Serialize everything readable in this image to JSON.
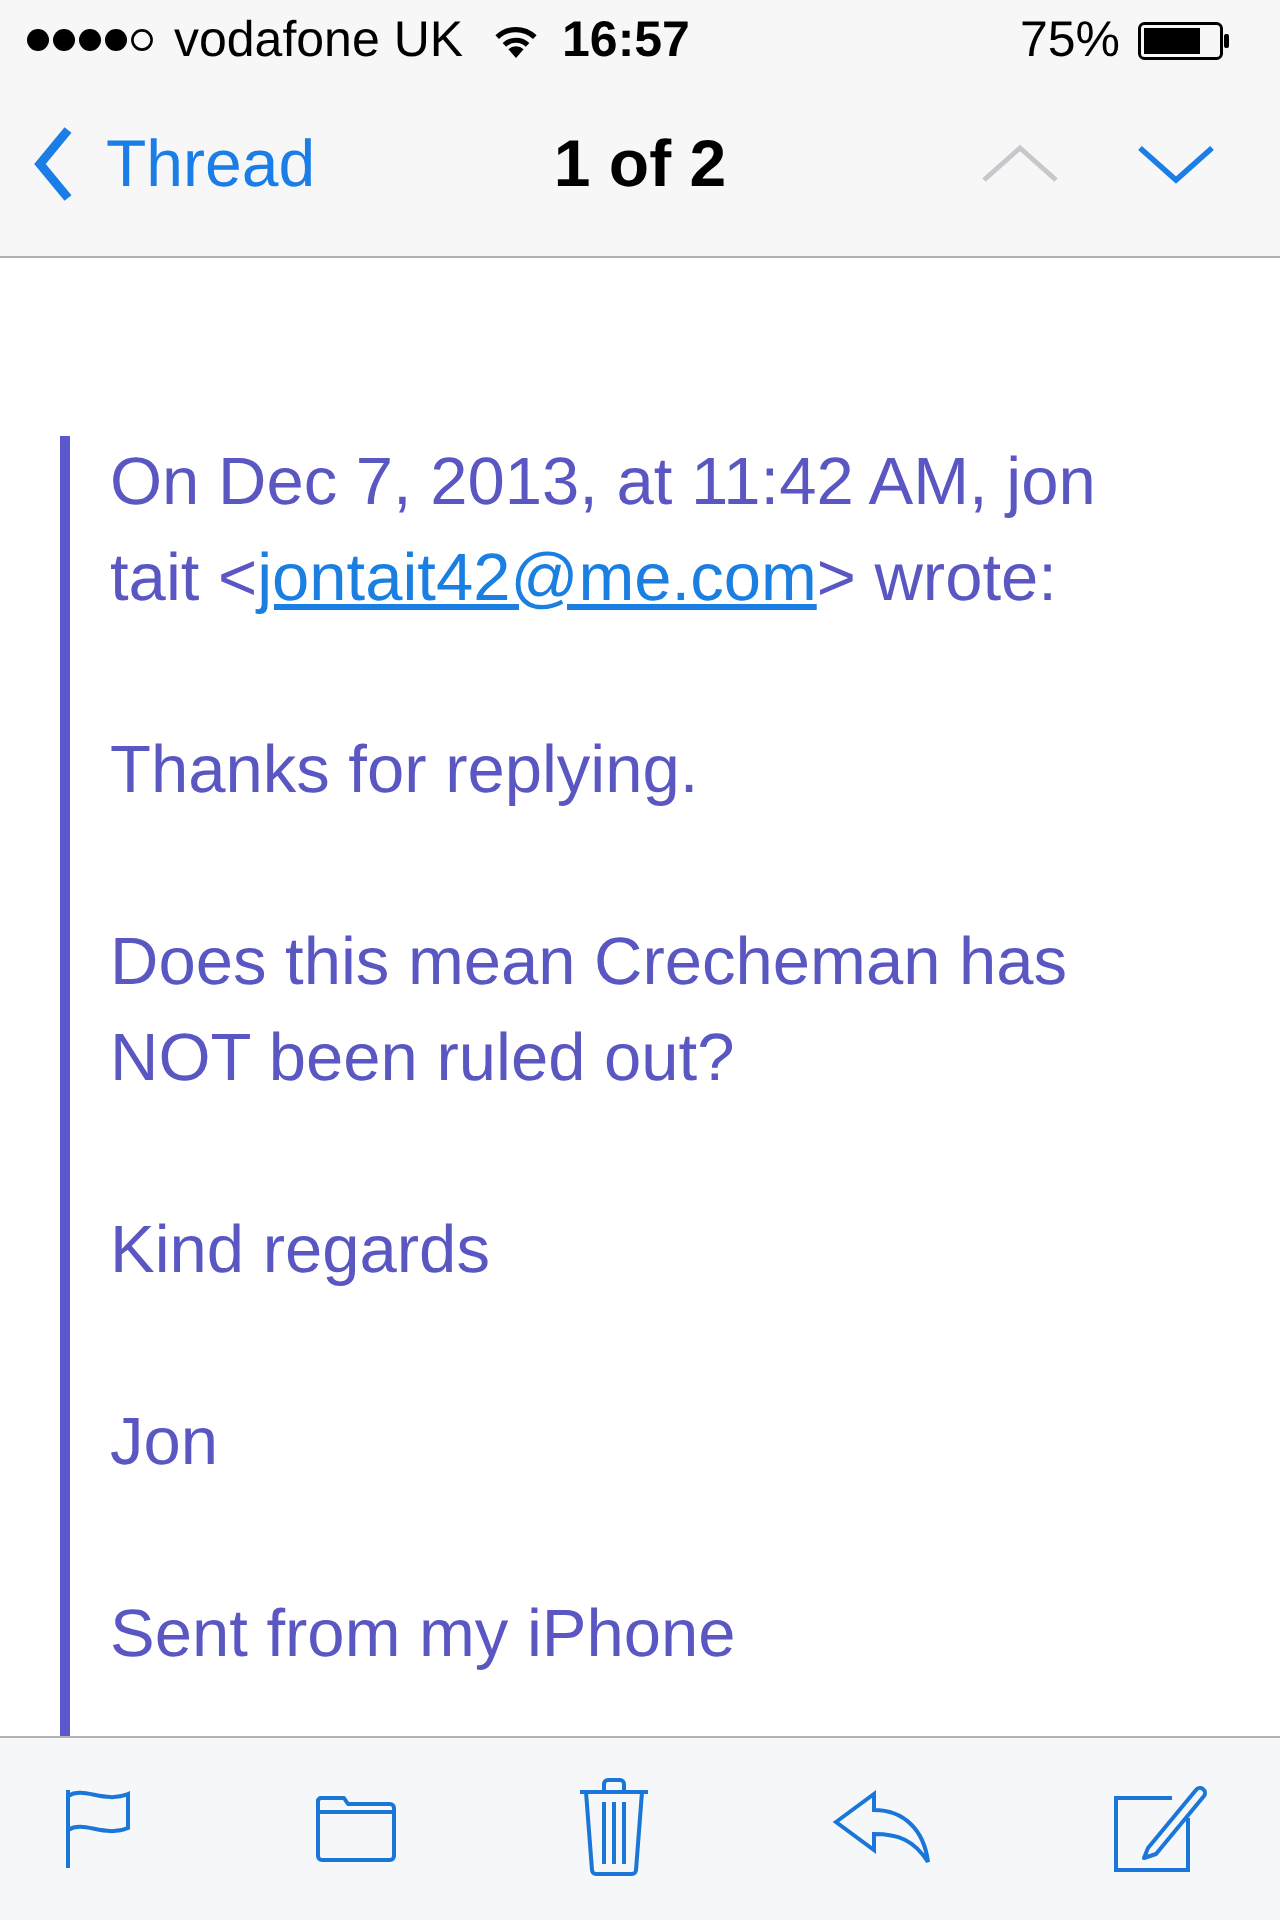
{
  "status_bar": {
    "carrier": "vodafone UK",
    "time": "16:57",
    "battery": "75%"
  },
  "nav_bar": {
    "back_label": "Thread",
    "position": "1 of 2",
    "previous_enabled": false,
    "next_enabled": true
  },
  "message": {
    "quote_header": {
      "before": "On Dec 7, 2013, at 11:42 AM, jon tait <",
      "link": "jontait42@me.com",
      "after": "> wrote:"
    },
    "paragraphs": [
      "Thanks for replying.",
      "Does this mean Crecheman has NOT been ruled out?",
      "Kind regards",
      "Jon",
      "Sent from my iPhone"
    ]
  }
}
